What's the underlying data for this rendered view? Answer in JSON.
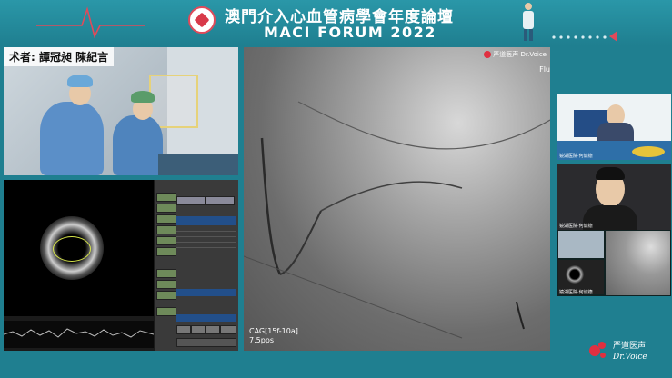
{
  "header": {
    "title_zh": "澳門介入心血管病學會年度論壇",
    "title_en": "MACI FORUM 2022"
  },
  "panels": {
    "surgery": {
      "label": "术者: 譚冠昶 陳紀言"
    },
    "angio": {
      "watermark": "严道医声 Dr.Voice",
      "side_text": "Flu",
      "info_line1": "CAG[15f-10a]",
      "info_line2": "7.5pps"
    },
    "cam1": {
      "label": "镜湖医院·何诚德"
    },
    "cam2": {
      "label": "镜湖医院·何诚德"
    },
    "thumbs": {
      "label": "镜湖医院·何诚德"
    }
  },
  "brand": {
    "name_zh": "严道医声",
    "name_en": "Dr.Voice"
  },
  "colors": {
    "background": "#1f7f90",
    "accent": "#e04a5a",
    "lumen": "#d8e64a"
  }
}
